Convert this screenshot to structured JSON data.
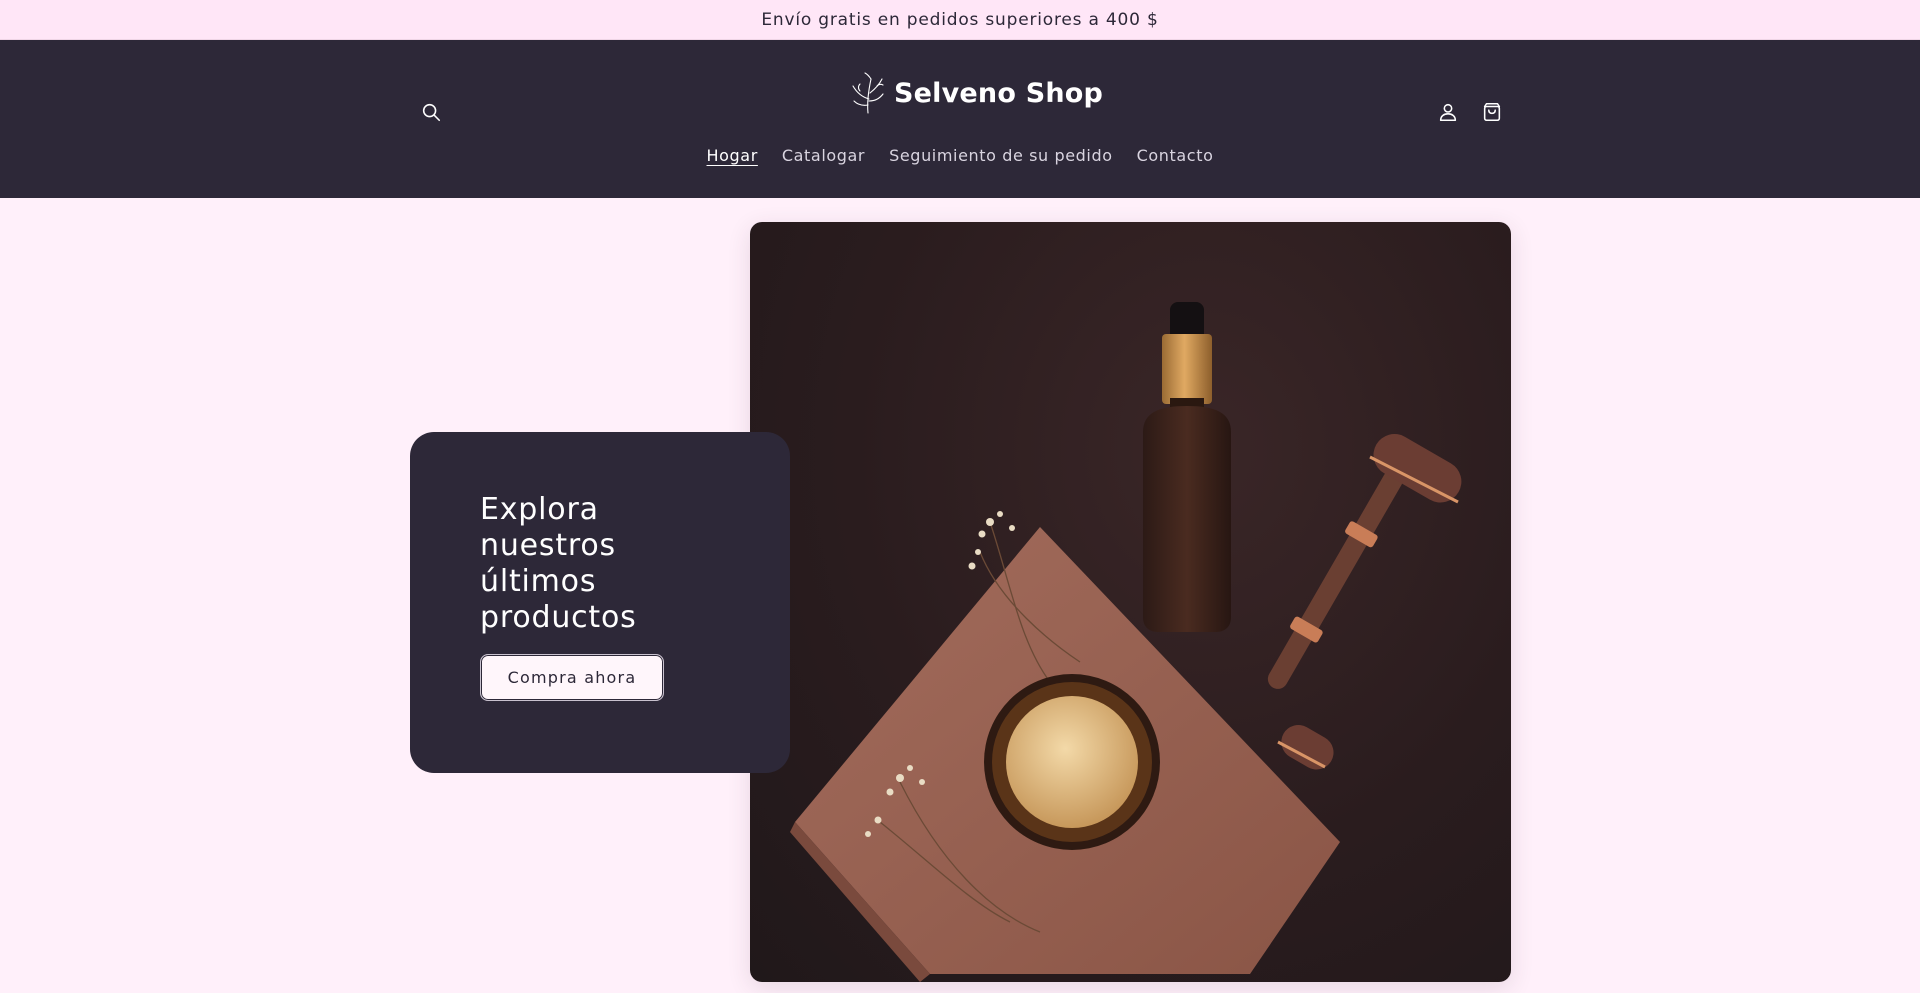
{
  "announcement": {
    "text": "Envío gratis en pedidos superiores a 400 $"
  },
  "header": {
    "logo_text": "Selveno Shop",
    "icons": {
      "search": "search-icon",
      "account": "user-icon",
      "cart": "bag-icon"
    }
  },
  "nav": {
    "items": [
      {
        "label": "Hogar",
        "active": true
      },
      {
        "label": "Catalogar"
      },
      {
        "label": "Seguimiento de su pedido"
      },
      {
        "label": "Contacto"
      }
    ]
  },
  "hero": {
    "title": "Explora nuestros últimos productos",
    "button_label": "Compra ahora"
  },
  "colors": {
    "page_background": "#fff0fa",
    "announcement_background": "#ffe6f7",
    "header_background": "#2d2838",
    "card_background": "#2d2838",
    "button_background": "#fff6fb"
  }
}
